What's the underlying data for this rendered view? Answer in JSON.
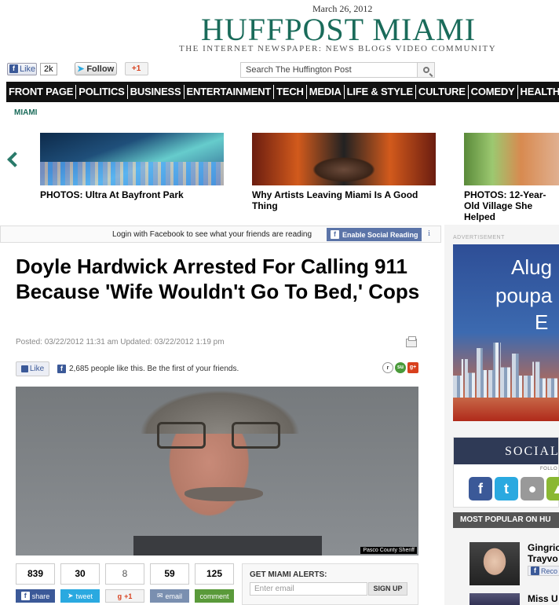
{
  "masthead": {
    "date": "March 26, 2012",
    "title": "HUFFPOST MIAMI",
    "tagline": "THE INTERNET NEWSPAPER: NEWS BLOGS VIDEO COMMUNITY"
  },
  "social_top": {
    "like_label": "Like",
    "like_count": "2k",
    "follow_label": "Follow",
    "gplus_label": "+1"
  },
  "search": {
    "placeholder": "Search The Huffington Post"
  },
  "nav": [
    "FRONT PAGE",
    "POLITICS",
    "BUSINESS",
    "ENTERTAINMENT",
    "TECH",
    "MEDIA",
    "LIFE & STYLE",
    "CULTURE",
    "COMEDY",
    "HEALTHY LIVING"
  ],
  "section": "MIAMI",
  "carousel": [
    {
      "caption": "PHOTOS: Ultra At Bayfront Park"
    },
    {
      "caption": "Why Artists Leaving Miami Is A Good Thing"
    },
    {
      "caption": "PHOTOS: 12-Year-Old Village She Helped"
    }
  ],
  "fb_bar": {
    "text": "Login with Facebook to see what your friends are reading",
    "button": "Enable Social Reading",
    "info": "i"
  },
  "article": {
    "headline": "Doyle Hardwick Arrested For Calling 911 Because 'Wife Wouldn't Go To Bed,' Cops",
    "meta": "Posted: 03/22/2012 11:31 am Updated: 03/22/2012 1:19 pm",
    "like_label": "Like",
    "like_text": "2,685 people like this. Be the first of your friends.",
    "photo_credit": "Pasco County Sheriff"
  },
  "share": [
    {
      "count": "839",
      "label": "share",
      "color": "#3b5998"
    },
    {
      "count": "30",
      "label": "tweet",
      "color": "#2aa9e0"
    },
    {
      "count": "8",
      "label": "+1",
      "color": "#f3f3f3"
    },
    {
      "count": "59",
      "label": "email",
      "color": "#7a8fb0"
    },
    {
      "count": "125",
      "label": "comment",
      "color": "#5a9a3a"
    }
  ],
  "alerts": {
    "title": "GET MIAMI ALERTS:",
    "placeholder": "Enter email",
    "button": "SIGN UP"
  },
  "sidebar": {
    "ad_label": "ADVERTISEMENT",
    "ad_lines": [
      "Alug",
      "poupa",
      "E"
    ],
    "social_title": "SOCIAL",
    "follow_label": "FOLLO",
    "popular_title": "MOST POPULAR ON HU",
    "popular_items": [
      {
        "title_line1": "Gingric",
        "title_line2": "Trayvo",
        "recommend": "Reco"
      },
      {
        "title_line1": "Miss U"
      }
    ]
  },
  "colors": {
    "brand": "#1a6b5a",
    "nav_bg": "#111111",
    "facebook": "#3b5998"
  }
}
